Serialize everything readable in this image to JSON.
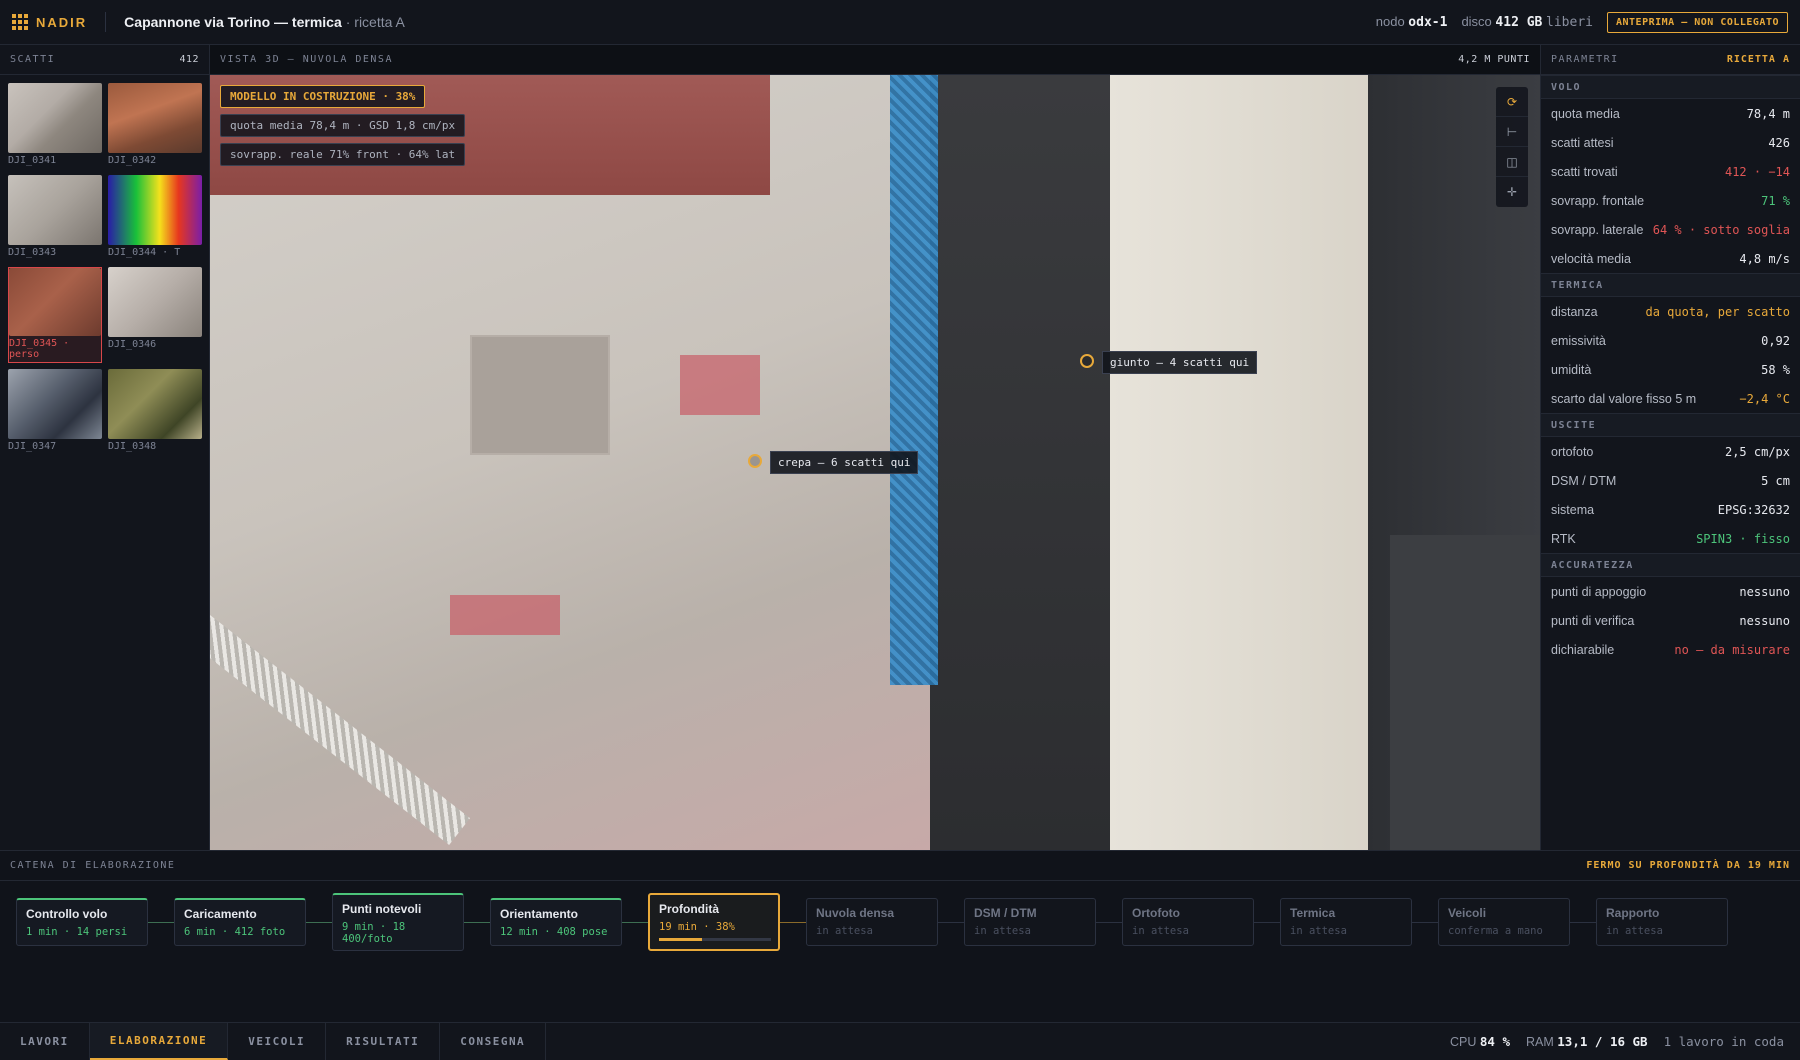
{
  "topbar": {
    "brand": "NADIR",
    "project_title": "Capannone via Torino — termica",
    "project_sub": "· ricetta A",
    "node_label": "nodo",
    "node_value": "odx-1",
    "disk_label": "disco",
    "disk_value": "412 GB",
    "disk_suffix": "liberi",
    "preview_badge": "ANTEPRIMA — NON COLLEGATO"
  },
  "photos": {
    "title": "SCATTI",
    "count": "412",
    "items": [
      {
        "name": "DJI_0341"
      },
      {
        "name": "DJI_0342"
      },
      {
        "name": "DJI_0343"
      },
      {
        "name": "DJI_0344 · T"
      },
      {
        "name": "DJI_0345 · perso"
      },
      {
        "name": "DJI_0346"
      },
      {
        "name": "DJI_0347"
      },
      {
        "name": "DJI_0348"
      }
    ]
  },
  "viewport": {
    "title": "VISTA 3D — NUVOLA DENSA",
    "points": "4,2 M PUNTI",
    "overlay_build": "MODELLO IN COSTRUZIONE · 38%",
    "overlay_altitude": "quota media 78,4 m · GSD 1,8 cm/px",
    "overlay_overlap": "sovrapp. reale 71% front · 64% lat",
    "tools": [
      "rotate-icon",
      "measure-icon",
      "layers-icon",
      "crosshair-icon"
    ],
    "markers": [
      {
        "label": "giunto — 4 scatti qui"
      },
      {
        "label": "crepa — 6 scatti qui"
      }
    ]
  },
  "params": {
    "title": "PARAMETRI",
    "recipe": "RICETTA A",
    "sections": [
      {
        "title": "VOLO",
        "rows": [
          {
            "k": "quota media",
            "v": "78,4 m",
            "tone": ""
          },
          {
            "k": "scatti attesi",
            "v": "426",
            "tone": ""
          },
          {
            "k": "scatti trovati",
            "v": "412 · −14",
            "tone": "red"
          },
          {
            "k": "sovrapp. frontale",
            "v": "71 %",
            "tone": "green"
          },
          {
            "k": "sovrapp. laterale",
            "v": "64 % · sotto soglia",
            "tone": "red"
          },
          {
            "k": "velocità media",
            "v": "4,8 m/s",
            "tone": ""
          }
        ]
      },
      {
        "title": "TERMICA",
        "rows": [
          {
            "k": "distanza",
            "v": "da quota, per scatto",
            "tone": "amber"
          },
          {
            "k": "emissività",
            "v": "0,92",
            "tone": ""
          },
          {
            "k": "umidità",
            "v": "58 %",
            "tone": ""
          },
          {
            "k": "scarto dal valore fisso 5 m",
            "v": "−2,4 °C",
            "tone": "amber"
          }
        ]
      },
      {
        "title": "USCITE",
        "rows": [
          {
            "k": "ortofoto",
            "v": "2,5 cm/px",
            "tone": ""
          },
          {
            "k": "DSM / DTM",
            "v": "5 cm",
            "tone": ""
          },
          {
            "k": "sistema",
            "v": "EPSG:32632",
            "tone": ""
          },
          {
            "k": "RTK",
            "v": "SPIN3 · fisso",
            "tone": "green"
          }
        ]
      },
      {
        "title": "ACCURATEZZA",
        "rows": [
          {
            "k": "punti di appoggio",
            "v": "nessuno",
            "tone": ""
          },
          {
            "k": "punti di verifica",
            "v": "nessuno",
            "tone": ""
          },
          {
            "k": "dichiarabile",
            "v": "no — da misurare",
            "tone": "red"
          }
        ]
      }
    ]
  },
  "pipeline": {
    "title": "CATENA DI ELABORAZIONE",
    "status": "FERMO SU PROFONDITÀ DA 19 MIN",
    "stages": [
      {
        "name": "Controllo volo",
        "detail": "1 min · 14 persi",
        "state": "done"
      },
      {
        "name": "Caricamento",
        "detail": "6 min · 412 foto",
        "state": "done"
      },
      {
        "name": "Punti notevoli",
        "detail": "9 min · 18 400/foto",
        "state": "done"
      },
      {
        "name": "Orientamento",
        "detail": "12 min · 408 pose",
        "state": "done"
      },
      {
        "name": "Profondità",
        "detail": "19 min · 38%",
        "state": "run",
        "progress": 0.38
      },
      {
        "name": "Nuvola densa",
        "detail": "in attesa",
        "state": "wait"
      },
      {
        "name": "DSM / DTM",
        "detail": "in attesa",
        "state": "wait"
      },
      {
        "name": "Ortofoto",
        "detail": "in attesa",
        "state": "wait"
      },
      {
        "name": "Termica",
        "detail": "in attesa",
        "state": "wait"
      },
      {
        "name": "Veicoli",
        "detail": "conferma a mano",
        "state": "wait"
      },
      {
        "name": "Rapporto",
        "detail": "in attesa",
        "state": "wait"
      }
    ]
  },
  "bottom": {
    "tabs": [
      "LAVORI",
      "ELABORAZIONE",
      "VEICOLI",
      "RISULTATI",
      "CONSEGNA"
    ],
    "active_tab": "ELABORAZIONE",
    "cpu_label": "CPU",
    "cpu_value": "84 %",
    "ram_label": "RAM",
    "ram_value": "13,1 / 16 GB",
    "queue": "1 lavoro in coda"
  },
  "colors": {
    "accent": "#e8a93a",
    "ok": "#4cc47a",
    "error": "#e05555"
  }
}
